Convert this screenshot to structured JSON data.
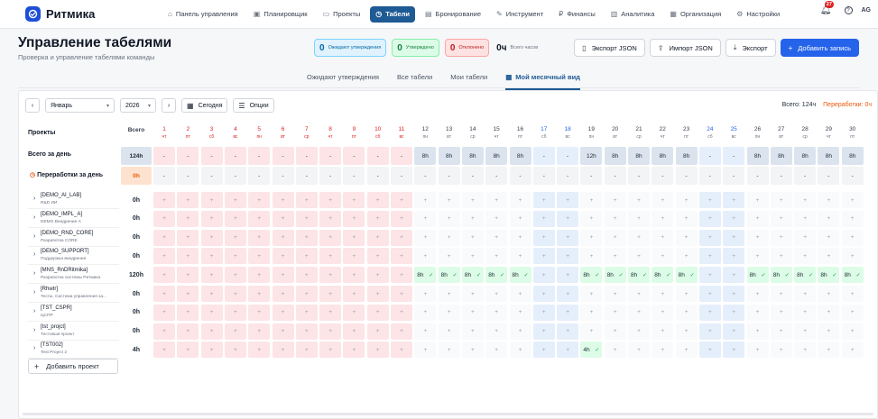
{
  "app": {
    "title": "Ритмика"
  },
  "nav": [
    {
      "icon": "⌂",
      "label": "Панель управления",
      "active": false
    },
    {
      "icon": "▣",
      "label": "Планировщик",
      "active": false
    },
    {
      "icon": "▭",
      "label": "Проекты",
      "active": false
    },
    {
      "icon": "◷",
      "label": "Табели",
      "active": true
    },
    {
      "icon": "▤",
      "label": "Бронирование",
      "active": false
    },
    {
      "icon": "✎",
      "label": "Инструмент",
      "active": false
    },
    {
      "icon": "₽",
      "label": "Финансы",
      "active": false
    },
    {
      "icon": "▥",
      "label": "Аналитика",
      "active": false
    },
    {
      "icon": "▦",
      "label": "Организация",
      "active": false
    },
    {
      "icon": "⚙",
      "label": "Настройки",
      "active": false
    }
  ],
  "header": {
    "notifications": "27",
    "help": "?",
    "user": "AG",
    "title": "Управление табелями",
    "subtitle": "Проверка и управление табелями команды"
  },
  "stats": {
    "pending": {
      "value": "0",
      "label": "Ожидают утверждения"
    },
    "approved": {
      "value": "0",
      "label": "Утверждено"
    },
    "rejected": {
      "value": "0",
      "label": "Отклонено"
    },
    "total": {
      "value": "0ч",
      "label": "Всего часов"
    }
  },
  "actions": {
    "export_json": "Экспорт JSON",
    "import_json": "Импорт JSON",
    "export": "Экспорт",
    "add": "Добавить запись"
  },
  "tabs": [
    "Ожидают утверждения",
    "Все табели",
    "Мои табели",
    "Мой месячный вид"
  ],
  "toolbar": {
    "prev": "‹",
    "next": "›",
    "month": "Январь",
    "year": "2026",
    "today": "Сегодня",
    "options": "Опции",
    "total_label": "Всего: 124ч",
    "overtime_label": "Переработки: 0ч"
  },
  "grid": {
    "projects_header": "Проекты",
    "total_header": "Всего",
    "day_total_label": "Всего за день",
    "overtime_label": "Переработки за день",
    "total_value": "124h",
    "overtime_value": "0h",
    "add_project": "Добавить проект",
    "days": [
      {
        "d": "1",
        "w": "чт",
        "type": "holiday",
        "total": "-"
      },
      {
        "d": "2",
        "w": "пт",
        "type": "holiday",
        "total": "-"
      },
      {
        "d": "3",
        "w": "сб",
        "type": "holiday",
        "total": "-"
      },
      {
        "d": "4",
        "w": "вс",
        "type": "holiday",
        "total": "-"
      },
      {
        "d": "5",
        "w": "пн",
        "type": "holiday",
        "total": "-"
      },
      {
        "d": "6",
        "w": "вт",
        "type": "holiday",
        "total": "-"
      },
      {
        "d": "7",
        "w": "ср",
        "type": "holiday",
        "total": "-"
      },
      {
        "d": "8",
        "w": "чт",
        "type": "holiday",
        "total": "-"
      },
      {
        "d": "9",
        "w": "пт",
        "type": "holiday",
        "total": "-"
      },
      {
        "d": "10",
        "w": "сб",
        "type": "holiday",
        "total": "-"
      },
      {
        "d": "11",
        "w": "вс",
        "type": "holiday",
        "total": "-"
      },
      {
        "d": "12",
        "w": "пн",
        "type": "work",
        "total": "8h"
      },
      {
        "d": "13",
        "w": "вт",
        "type": "work",
        "total": "8h"
      },
      {
        "d": "14",
        "w": "ср",
        "type": "work",
        "total": "8h"
      },
      {
        "d": "15",
        "w": "чт",
        "type": "work",
        "total": "8h"
      },
      {
        "d": "16",
        "w": "пт",
        "type": "work",
        "total": "8h"
      },
      {
        "d": "17",
        "w": "сб",
        "type": "weekend",
        "total": "-"
      },
      {
        "d": "18",
        "w": "вс",
        "type": "weekend",
        "total": "-"
      },
      {
        "d": "19",
        "w": "пн",
        "type": "work",
        "total": "12h"
      },
      {
        "d": "20",
        "w": "вт",
        "type": "work",
        "total": "8h"
      },
      {
        "d": "21",
        "w": "ср",
        "type": "work",
        "total": "8h"
      },
      {
        "d": "22",
        "w": "чт",
        "type": "work",
        "total": "8h"
      },
      {
        "d": "23",
        "w": "пт",
        "type": "work",
        "total": "8h"
      },
      {
        "d": "24",
        "w": "сб",
        "type": "weekend",
        "total": "-"
      },
      {
        "d": "25",
        "w": "вс",
        "type": "weekend",
        "total": "-"
      },
      {
        "d": "26",
        "w": "пн",
        "type": "work",
        "total": "8h"
      },
      {
        "d": "27",
        "w": "вт",
        "type": "work",
        "total": "8h"
      },
      {
        "d": "28",
        "w": "ср",
        "type": "work",
        "total": "8h"
      },
      {
        "d": "29",
        "w": "чт",
        "type": "work",
        "total": "8h"
      },
      {
        "d": "30",
        "w": "пт",
        "type": "work",
        "total": "8h"
      }
    ],
    "overtime_cell": "-",
    "empty_cell": "+",
    "projects": [
      {
        "code": "[DEMO_AI_LAB]",
        "desc": "R&D ИИ",
        "total": "0h",
        "hours": {}
      },
      {
        "code": "[DEMO_IMPL_A]",
        "desc": "DEMO Внедрение A",
        "total": "0h",
        "hours": {}
      },
      {
        "code": "[DEMO_RND_CORE]",
        "desc": "Разработка CORE",
        "total": "0h",
        "hours": {}
      },
      {
        "code": "[DEMO_SUPPORT]",
        "desc": "Поддержка внедрения",
        "total": "0h",
        "hours": {}
      },
      {
        "code": "[MNS_RnDRitmika]",
        "desc": "Разработка системы Ритмика",
        "total": "120h",
        "hours": {
          "12": "8h",
          "13": "8h",
          "14": "8h",
          "15": "8h",
          "16": "8h",
          "19": "8h",
          "20": "8h",
          "21": "8h",
          "22": "8h",
          "23": "8h",
          "26": "8h",
          "27": "8h",
          "28": "8h",
          "29": "8h",
          "30": "8h"
        }
      },
      {
        "code": "[Rhwtr]",
        "desc": "Тесты. Система управления за...",
        "total": "0h",
        "hours": {}
      },
      {
        "code": "[TST_CSPR]",
        "desc": "ЦСПР",
        "total": "0h",
        "hours": {}
      },
      {
        "code": "[tst_projct]",
        "desc": "Тестовый проект",
        "total": "0h",
        "hours": {}
      },
      {
        "code": "[TST002]",
        "desc": "Test Project 2",
        "total": "4h",
        "hours": {
          "19": "4h"
        }
      }
    ]
  },
  "colors": {
    "holiday": "#fde4e6",
    "weekend": "#e5eefb",
    "work": "#f3f4f6",
    "filled": "#dcfce7",
    "accent": "#1e5a94"
  }
}
